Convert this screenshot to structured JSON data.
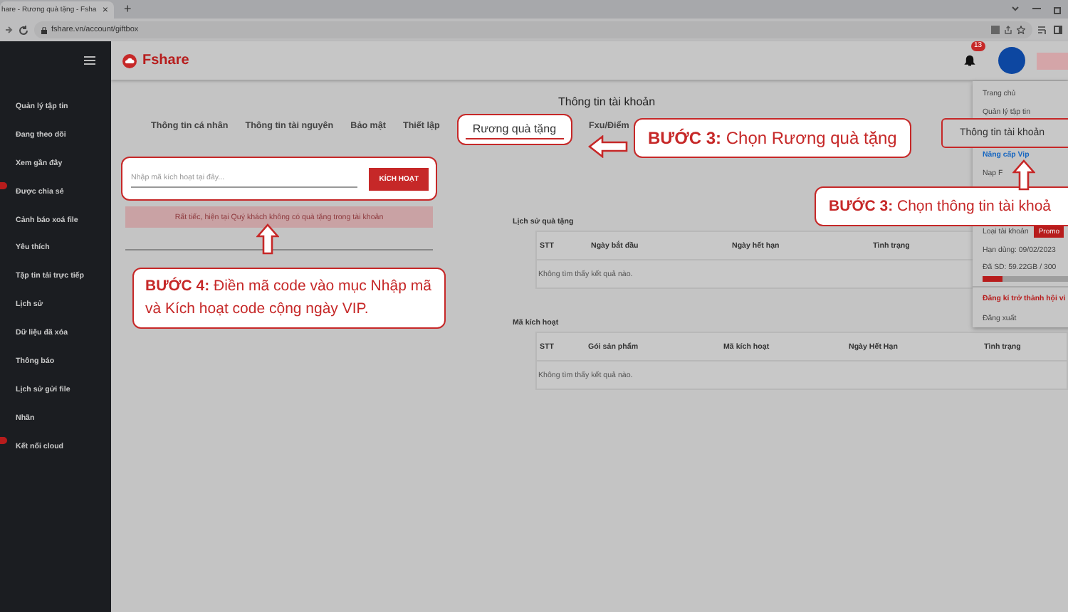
{
  "browser": {
    "tab_title": "hare - Rương quà tặng - Fsha",
    "tab_close": "×",
    "new_tab": "+",
    "url": "fshare.vn/account/giftbox"
  },
  "sidebar": {
    "items": [
      {
        "label": "Quản lý tập tin",
        "badge": false
      },
      {
        "label": "Đang theo dõi",
        "badge": false
      },
      {
        "label": "Xem gần đây",
        "badge": false
      },
      {
        "label": "Được chia sẻ",
        "badge": true
      },
      {
        "label": "Cảnh báo xoá file",
        "badge": false
      },
      {
        "label": "Yêu thích",
        "badge": false
      },
      {
        "label": "Tập tin tải trực tiếp",
        "badge": false
      },
      {
        "label": "Lịch sử",
        "badge": false
      },
      {
        "label": "Dữ liệu đã xóa",
        "badge": false
      },
      {
        "label": "Thông báo",
        "badge": false
      },
      {
        "label": "Lịch sử gửi file",
        "badge": false
      },
      {
        "label": "Nhãn",
        "badge": false
      },
      {
        "label": "Kết nối cloud",
        "badge": true
      }
    ]
  },
  "header": {
    "logo": "Fshare",
    "notification_count": "13"
  },
  "page": {
    "title": "Thông tin tài khoản",
    "tabs": [
      {
        "label": "Thông tin cá nhân",
        "selected": false
      },
      {
        "label": "Thông tin tài nguyên",
        "selected": false
      },
      {
        "label": "Bảo mật",
        "selected": false
      },
      {
        "label": "Thiết lập",
        "selected": false
      },
      {
        "label": "Rương quà tặng",
        "selected": true
      },
      {
        "label": "Fxu/Điểm",
        "selected": false
      }
    ],
    "code_input": {
      "placeholder": "Nhập mã kích hoạt tại đây...",
      "button": "KÍCH HOẠT"
    },
    "alert": "Rất tiếc, hiện tại Quý khách không có quà tặng trong tài khoản",
    "tables": [
      {
        "title": "Lịch sử quà tặng",
        "columns": [
          "STT",
          "Ngày bắt đầu",
          "Ngày hết hạn",
          "Tình trạng"
        ],
        "empty": "Không tìm thấy kết quả nào."
      },
      {
        "title": "Mã kích hoạt",
        "columns": [
          "STT",
          "Gói sản phẩm",
          "Mã kích hoạt",
          "Ngày Hết Hạn",
          "Tình trạng"
        ],
        "empty": "Không tìm thấy kết quả nào."
      }
    ]
  },
  "account_menu": {
    "items": [
      {
        "kind": "item",
        "label": "Trang chủ",
        "selected": false
      },
      {
        "kind": "item",
        "label": "Quản lý tập tin",
        "selected": false
      },
      {
        "kind": "item",
        "label": "Thông tin tài khoản",
        "selected": true
      },
      {
        "kind": "upgrade",
        "label": "Nâng cấp Vip",
        "selected": false
      },
      {
        "kind": "item",
        "label": "Nạp F",
        "selected": false
      },
      {
        "kind": "type",
        "label": "Loại tài khoản",
        "tag": "Promo"
      },
      {
        "kind": "info",
        "label": "Hạn dùng: 09/02/2023"
      },
      {
        "kind": "usage",
        "label": "Đã SD: 59.22GB / 300",
        "level": 0.2
      },
      {
        "kind": "register",
        "label": "Đăng kí trở thành hội vi"
      },
      {
        "kind": "item",
        "label": "Đăng xuất",
        "selected": false
      }
    ]
  },
  "callouts": [
    {
      "text": "**BƯỚC 3:** Chọn Rương quà tặng"
    },
    {
      "text": "**BƯỚC 3:** Chọn thông tin tài khoả"
    },
    {
      "text": "**BƯỚC 4:** Điền mã code vào mục Nhập mã và Kích hoạt code cộng ngày VIP."
    }
  ]
}
